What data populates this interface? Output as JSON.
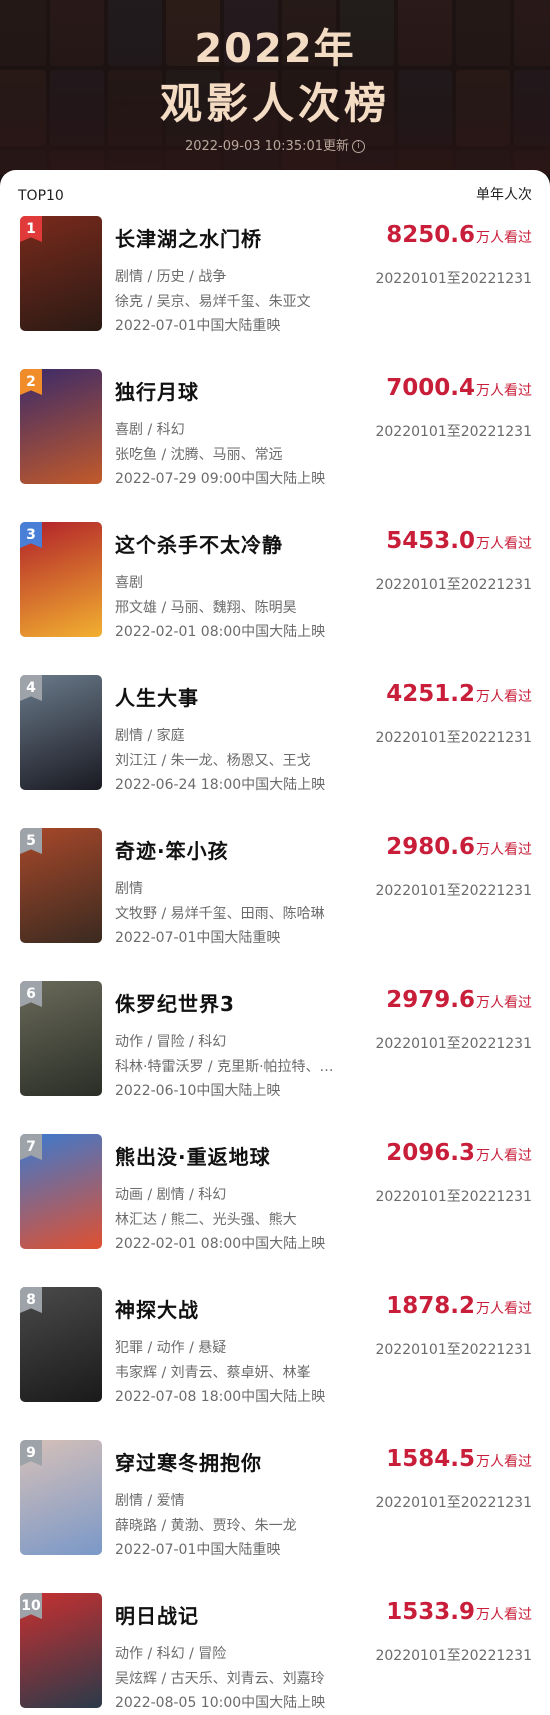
{
  "header": {
    "year_title": "2022年",
    "list_title": "观影人次榜",
    "updated": "2022-09-03 10:35:01更新",
    "info_icon": "info-icon"
  },
  "table": {
    "left_label": "TOP10",
    "right_label": "单年人次"
  },
  "unit_label": "万人看过",
  "movies": [
    {
      "rank": "1",
      "title": "长津湖之水门桥",
      "count": "8250.6",
      "genre": "剧情 / 历史 / 战争",
      "cast": "徐克 / 吴京、易烊千玺、朱亚文",
      "release": "2022-07-01中国大陆重映",
      "period": "20220101至20221231"
    },
    {
      "rank": "2",
      "title": "独行月球",
      "count": "7000.4",
      "genre": "喜剧 / 科幻",
      "cast": "张吃鱼 / 沈腾、马丽、常远",
      "release": "2022-07-29 09:00中国大陆上映",
      "period": "20220101至20221231"
    },
    {
      "rank": "3",
      "title": "这个杀手不太冷静",
      "count": "5453.0",
      "genre": "喜剧",
      "cast": "邢文雄 / 马丽、魏翔、陈明昊",
      "release": "2022-02-01 08:00中国大陆上映",
      "period": "20220101至20221231"
    },
    {
      "rank": "4",
      "title": "人生大事",
      "count": "4251.2",
      "genre": "剧情 / 家庭",
      "cast": "刘江江 / 朱一龙、杨恩又、王戈",
      "release": "2022-06-24 18:00中国大陆上映",
      "period": "20220101至20221231"
    },
    {
      "rank": "5",
      "title": "奇迹·笨小孩",
      "count": "2980.6",
      "genre": "剧情",
      "cast": "文牧野 / 易烊千玺、田雨、陈哈琳",
      "release": "2022-07-01中国大陆重映",
      "period": "20220101至20221231"
    },
    {
      "rank": "6",
      "title": "侏罗纪世界3",
      "count": "2979.6",
      "genre": "动作 / 冒险 / 科幻",
      "cast": "科林·特雷沃罗 / 克里斯·帕拉特、…",
      "release": "2022-06-10中国大陆上映",
      "period": "20220101至20221231"
    },
    {
      "rank": "7",
      "title": "熊出没·重返地球",
      "count": "2096.3",
      "genre": "动画 / 剧情 / 科幻",
      "cast": "林汇达 / 熊二、光头强、熊大",
      "release": "2022-02-01 08:00中国大陆上映",
      "period": "20220101至20221231"
    },
    {
      "rank": "8",
      "title": "神探大战",
      "count": "1878.2",
      "genre": "犯罪 / 动作 / 悬疑",
      "cast": "韦家辉 / 刘青云、蔡卓妍、林峯",
      "release": "2022-07-08 18:00中国大陆上映",
      "period": "20220101至20221231"
    },
    {
      "rank": "9",
      "title": "穿过寒冬拥抱你",
      "count": "1584.5",
      "genre": "剧情 / 爱情",
      "cast": "薛晓路 / 黄渤、贾玲、朱一龙",
      "release": "2022-07-01中国大陆重映",
      "period": "20220101至20221231"
    },
    {
      "rank": "10",
      "title": "明日战记",
      "count": "1533.9",
      "genre": "动作 / 科幻 / 冒险",
      "cast": "吴炫辉 / 古天乐、刘青云、刘嘉玲",
      "release": "2022-08-05 10:00中国大陆上映",
      "period": "20220101至20221231"
    }
  ],
  "colors": {
    "accent": "#c81e3a",
    "title_gold": "#f4dcc4",
    "rank1": "#e03a3a",
    "rank2": "#f08c2a",
    "rank3": "#4a7fd8",
    "rank_other": "#9ea3aa"
  }
}
